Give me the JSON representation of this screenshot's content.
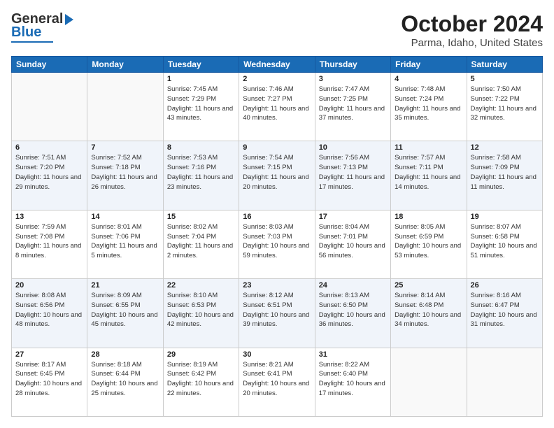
{
  "header": {
    "logo_top": "General",
    "logo_bottom": "Blue",
    "title": "October 2024",
    "subtitle": "Parma, Idaho, United States"
  },
  "weekdays": [
    "Sunday",
    "Monday",
    "Tuesday",
    "Wednesday",
    "Thursday",
    "Friday",
    "Saturday"
  ],
  "weeks": [
    [
      {
        "day": "",
        "info": ""
      },
      {
        "day": "",
        "info": ""
      },
      {
        "day": "1",
        "info": "Sunrise: 7:45 AM\nSunset: 7:29 PM\nDaylight: 11 hours and 43 minutes."
      },
      {
        "day": "2",
        "info": "Sunrise: 7:46 AM\nSunset: 7:27 PM\nDaylight: 11 hours and 40 minutes."
      },
      {
        "day": "3",
        "info": "Sunrise: 7:47 AM\nSunset: 7:25 PM\nDaylight: 11 hours and 37 minutes."
      },
      {
        "day": "4",
        "info": "Sunrise: 7:48 AM\nSunset: 7:24 PM\nDaylight: 11 hours and 35 minutes."
      },
      {
        "day": "5",
        "info": "Sunrise: 7:50 AM\nSunset: 7:22 PM\nDaylight: 11 hours and 32 minutes."
      }
    ],
    [
      {
        "day": "6",
        "info": "Sunrise: 7:51 AM\nSunset: 7:20 PM\nDaylight: 11 hours and 29 minutes."
      },
      {
        "day": "7",
        "info": "Sunrise: 7:52 AM\nSunset: 7:18 PM\nDaylight: 11 hours and 26 minutes."
      },
      {
        "day": "8",
        "info": "Sunrise: 7:53 AM\nSunset: 7:16 PM\nDaylight: 11 hours and 23 minutes."
      },
      {
        "day": "9",
        "info": "Sunrise: 7:54 AM\nSunset: 7:15 PM\nDaylight: 11 hours and 20 minutes."
      },
      {
        "day": "10",
        "info": "Sunrise: 7:56 AM\nSunset: 7:13 PM\nDaylight: 11 hours and 17 minutes."
      },
      {
        "day": "11",
        "info": "Sunrise: 7:57 AM\nSunset: 7:11 PM\nDaylight: 11 hours and 14 minutes."
      },
      {
        "day": "12",
        "info": "Sunrise: 7:58 AM\nSunset: 7:09 PM\nDaylight: 11 hours and 11 minutes."
      }
    ],
    [
      {
        "day": "13",
        "info": "Sunrise: 7:59 AM\nSunset: 7:08 PM\nDaylight: 11 hours and 8 minutes."
      },
      {
        "day": "14",
        "info": "Sunrise: 8:01 AM\nSunset: 7:06 PM\nDaylight: 11 hours and 5 minutes."
      },
      {
        "day": "15",
        "info": "Sunrise: 8:02 AM\nSunset: 7:04 PM\nDaylight: 11 hours and 2 minutes."
      },
      {
        "day": "16",
        "info": "Sunrise: 8:03 AM\nSunset: 7:03 PM\nDaylight: 10 hours and 59 minutes."
      },
      {
        "day": "17",
        "info": "Sunrise: 8:04 AM\nSunset: 7:01 PM\nDaylight: 10 hours and 56 minutes."
      },
      {
        "day": "18",
        "info": "Sunrise: 8:05 AM\nSunset: 6:59 PM\nDaylight: 10 hours and 53 minutes."
      },
      {
        "day": "19",
        "info": "Sunrise: 8:07 AM\nSunset: 6:58 PM\nDaylight: 10 hours and 51 minutes."
      }
    ],
    [
      {
        "day": "20",
        "info": "Sunrise: 8:08 AM\nSunset: 6:56 PM\nDaylight: 10 hours and 48 minutes."
      },
      {
        "day": "21",
        "info": "Sunrise: 8:09 AM\nSunset: 6:55 PM\nDaylight: 10 hours and 45 minutes."
      },
      {
        "day": "22",
        "info": "Sunrise: 8:10 AM\nSunset: 6:53 PM\nDaylight: 10 hours and 42 minutes."
      },
      {
        "day": "23",
        "info": "Sunrise: 8:12 AM\nSunset: 6:51 PM\nDaylight: 10 hours and 39 minutes."
      },
      {
        "day": "24",
        "info": "Sunrise: 8:13 AM\nSunset: 6:50 PM\nDaylight: 10 hours and 36 minutes."
      },
      {
        "day": "25",
        "info": "Sunrise: 8:14 AM\nSunset: 6:48 PM\nDaylight: 10 hours and 34 minutes."
      },
      {
        "day": "26",
        "info": "Sunrise: 8:16 AM\nSunset: 6:47 PM\nDaylight: 10 hours and 31 minutes."
      }
    ],
    [
      {
        "day": "27",
        "info": "Sunrise: 8:17 AM\nSunset: 6:45 PM\nDaylight: 10 hours and 28 minutes."
      },
      {
        "day": "28",
        "info": "Sunrise: 8:18 AM\nSunset: 6:44 PM\nDaylight: 10 hours and 25 minutes."
      },
      {
        "day": "29",
        "info": "Sunrise: 8:19 AM\nSunset: 6:42 PM\nDaylight: 10 hours and 22 minutes."
      },
      {
        "day": "30",
        "info": "Sunrise: 8:21 AM\nSunset: 6:41 PM\nDaylight: 10 hours and 20 minutes."
      },
      {
        "day": "31",
        "info": "Sunrise: 8:22 AM\nSunset: 6:40 PM\nDaylight: 10 hours and 17 minutes."
      },
      {
        "day": "",
        "info": ""
      },
      {
        "day": "",
        "info": ""
      }
    ]
  ]
}
